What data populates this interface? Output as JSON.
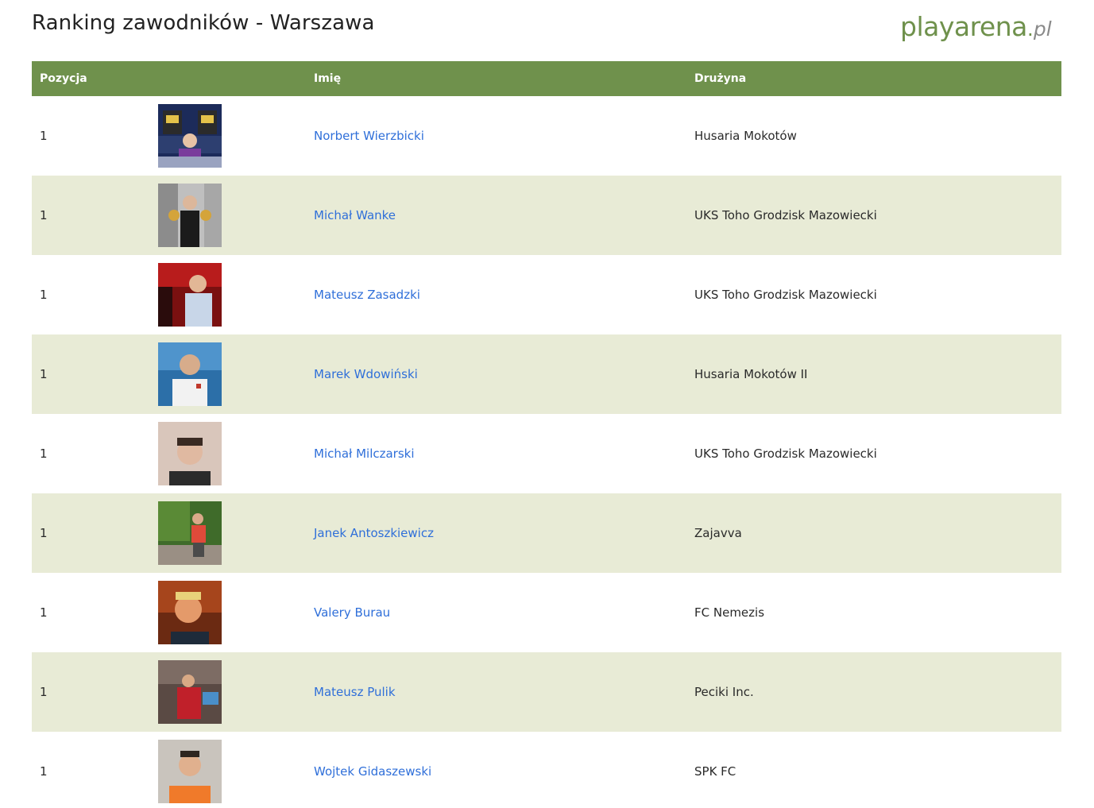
{
  "page_title": "Ranking zawodników - Warszawa",
  "logo": {
    "main": "playarena",
    "dot": ".",
    "tld": "pl",
    "color": "#6f914c"
  },
  "table": {
    "headers": {
      "position": "Pozycja",
      "photo": "",
      "name": "Imię",
      "team": "Drużyna"
    },
    "header_color": "#6f914c",
    "stripe_color": "#e8ebd6",
    "link_color": "#2f6fd9",
    "rows": [
      {
        "position": "1",
        "name": "Norbert Wierzbicki",
        "team": "Husaria Mokotów",
        "photo": "player-photo"
      },
      {
        "position": "1",
        "name": "Michał Wanke",
        "team": "UKS Toho Grodzisk Mazowiecki",
        "photo": "player-photo"
      },
      {
        "position": "1",
        "name": "Mateusz Zasadzki",
        "team": "UKS Toho Grodzisk Mazowiecki",
        "photo": "player-photo"
      },
      {
        "position": "1",
        "name": "Marek Wdowiński",
        "team": "Husaria Mokotów II",
        "photo": "player-photo"
      },
      {
        "position": "1",
        "name": "Michał Milczarski",
        "team": "UKS Toho Grodzisk Mazowiecki",
        "photo": "player-photo"
      },
      {
        "position": "1",
        "name": "Janek Antoszkiewicz",
        "team": "Zajavva",
        "photo": "player-photo"
      },
      {
        "position": "1",
        "name": "Valery Burau",
        "team": "FC Nemezis",
        "photo": "player-photo"
      },
      {
        "position": "1",
        "name": "Mateusz Pulik",
        "team": "Peciki Inc.",
        "photo": "player-photo"
      },
      {
        "position": "1",
        "name": "Wojtek Gidaszewski",
        "team": "SPK FC",
        "photo": "player-photo"
      }
    ]
  }
}
